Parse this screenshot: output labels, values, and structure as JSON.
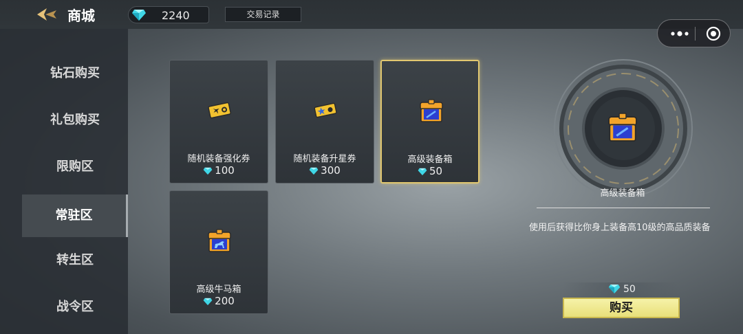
{
  "header": {
    "title": "商城",
    "diamonds": "2240",
    "record_label": "交易记录"
  },
  "sidebar": {
    "items": [
      {
        "label": "钻石购买"
      },
      {
        "label": "礼包购买"
      },
      {
        "label": "限购区"
      },
      {
        "label": "常驻区"
      },
      {
        "label": "转生区"
      },
      {
        "label": "战令区"
      }
    ],
    "active_index": 3
  },
  "products": [
    {
      "name": "随机装备强化券",
      "price": "100",
      "icon": "ticket-icon"
    },
    {
      "name": "随机装备升星券",
      "price": "300",
      "icon": "star-ticket-icon"
    },
    {
      "name": "高级装备箱",
      "price": "50",
      "icon": "equipment-chest-icon",
      "selected": true
    },
    {
      "name": "高级牛马箱",
      "price": "200",
      "icon": "horse-chest-icon"
    }
  ],
  "detail": {
    "name": "高级装备箱",
    "description": "使用后获得比你身上装备高10级的高品质装备",
    "price": "50",
    "buy_label": "购买"
  },
  "colors": {
    "accent_gold": "#e2c870",
    "buy_button": "#f3ee9a",
    "diamond": "#4fe3ef"
  }
}
